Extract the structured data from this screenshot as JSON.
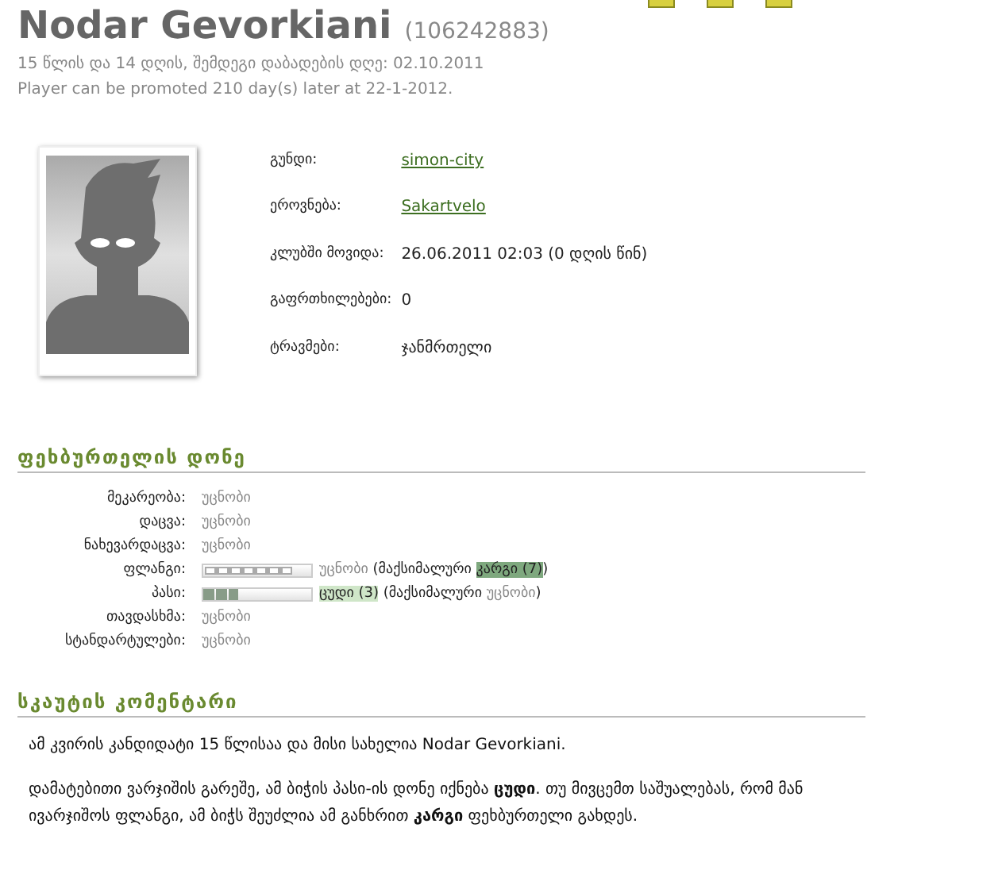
{
  "header": {
    "name": "Nodar Gevorkiani",
    "id": "(106242883)",
    "age_line": "15 წლის და 14 დღის, შემდეგი დაბადების დღე: 02.10.2011",
    "promotion_line": "Player can be promoted 210 day(s) later at 22-1-2012."
  },
  "top_icons": [
    {
      "kind": "square"
    },
    {
      "kind": "square"
    },
    {
      "kind": "square"
    }
  ],
  "photo": {
    "kind": "avatar"
  },
  "info": [
    {
      "label": "გუნდი:",
      "value": "simon-city",
      "link": true
    },
    {
      "label": "ეროვნება:",
      "value": "Sakartvelo",
      "link": true
    },
    {
      "label": "კლუბში მოვიდა:",
      "value": "26.06.2011 02:03 (0 დღის წინ)",
      "link": false
    },
    {
      "label": "გაფრთხილებები:",
      "value": "0",
      "link": false
    },
    {
      "label": "ტრავმები:",
      "value": "ჯანმრთელი",
      "link": false
    }
  ],
  "skills_title": "ფეხბურთელის დონე",
  "skills": [
    {
      "label": "მეკარეობა:",
      "kind": "text",
      "parts": [
        {
          "text": "უცნობი",
          "kind": "muted"
        }
      ]
    },
    {
      "label": "დაცვა:",
      "kind": "text",
      "parts": [
        {
          "text": "უცნობი",
          "kind": "muted"
        }
      ]
    },
    {
      "label": "ნახევარდაცვა:",
      "kind": "text",
      "parts": [
        {
          "text": "უცნობი",
          "kind": "muted"
        }
      ]
    },
    {
      "label": "ფლანგი:",
      "kind": "bar",
      "outlined": true,
      "parts": [
        {
          "text": "უცნობი",
          "kind": "muted"
        },
        {
          "text": " (მაქსიმალური ",
          "kind": "plain"
        },
        {
          "text": "კარგი (7)",
          "kind": "good"
        },
        {
          "text": ")",
          "kind": "plain"
        }
      ]
    },
    {
      "label": "პასი:",
      "kind": "bar",
      "level": 0.33,
      "outlined": false,
      "parts": [
        {
          "text": "ცუდი (3)",
          "kind": "bad"
        },
        {
          "text": " (მაქსიმალური ",
          "kind": "plain"
        },
        {
          "text": "უცნობი",
          "kind": "muted"
        },
        {
          "text": ")",
          "kind": "plain"
        }
      ]
    },
    {
      "label": "თავდასხმა:",
      "kind": "text",
      "parts": [
        {
          "text": "უცნობი",
          "kind": "muted"
        }
      ]
    },
    {
      "label": "სტანდარტულები:",
      "kind": "text",
      "parts": [
        {
          "text": "უცნობი",
          "kind": "muted"
        }
      ]
    }
  ],
  "comment_title": "სკაუტის კომენტარი",
  "comment": [
    "ამ კვირის კანდიდატი 15 წლისაა და მისი სახელია Nodar Gevorkiani.",
    "დამატებითი ვარჯიშის გარეშე, ამ ბიჭის პასი-ის დონე იქნება **ცუდი**. თუ მივცემთ საშუალებას, რომ მან ივარჯიშოს ფლანგი, ამ ბიჭს შეუძლია ამ განხრით **კარგი** ფეხბურთელი გახდეს."
  ]
}
